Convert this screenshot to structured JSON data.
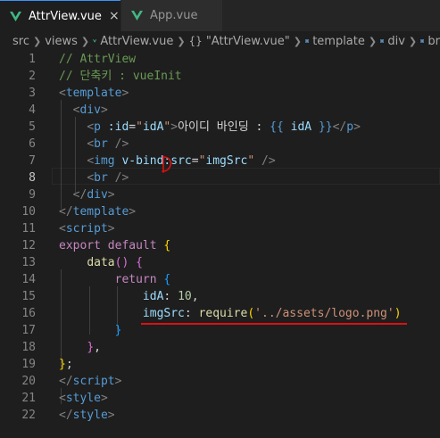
{
  "tabs": [
    {
      "label": "AttrView.vue",
      "close": "×"
    },
    {
      "label": "App.vue"
    }
  ],
  "breadcrumb": {
    "items": [
      "src",
      "views",
      "AttrView.vue",
      "\"AttrView.vue\"",
      "template",
      "div",
      "br"
    ],
    "object_glyph": "{}"
  },
  "editor": {
    "current_line": 8,
    "lines": [
      {
        "n": "1"
      },
      {
        "n": "2"
      },
      {
        "n": "3"
      },
      {
        "n": "4"
      },
      {
        "n": "5"
      },
      {
        "n": "6"
      },
      {
        "n": "7"
      },
      {
        "n": "8"
      },
      {
        "n": "9"
      },
      {
        "n": "10"
      },
      {
        "n": "11"
      },
      {
        "n": "12"
      },
      {
        "n": "13"
      },
      {
        "n": "14"
      },
      {
        "n": "15"
      },
      {
        "n": "16"
      },
      {
        "n": "17"
      },
      {
        "n": "18"
      },
      {
        "n": "19"
      },
      {
        "n": "20"
      },
      {
        "n": "21"
      },
      {
        "n": "22"
      }
    ],
    "code": {
      "l1": "// AttrView",
      "l2": "// 단축키 : vueInit",
      "l5_text": "아이디 바인딩 : ",
      "l5_var": "idA",
      "l16_path": "'../assets/logo.png'",
      "l15_num": "10"
    }
  },
  "annotation": {
    "mark": "D",
    "color": "#e01010"
  }
}
